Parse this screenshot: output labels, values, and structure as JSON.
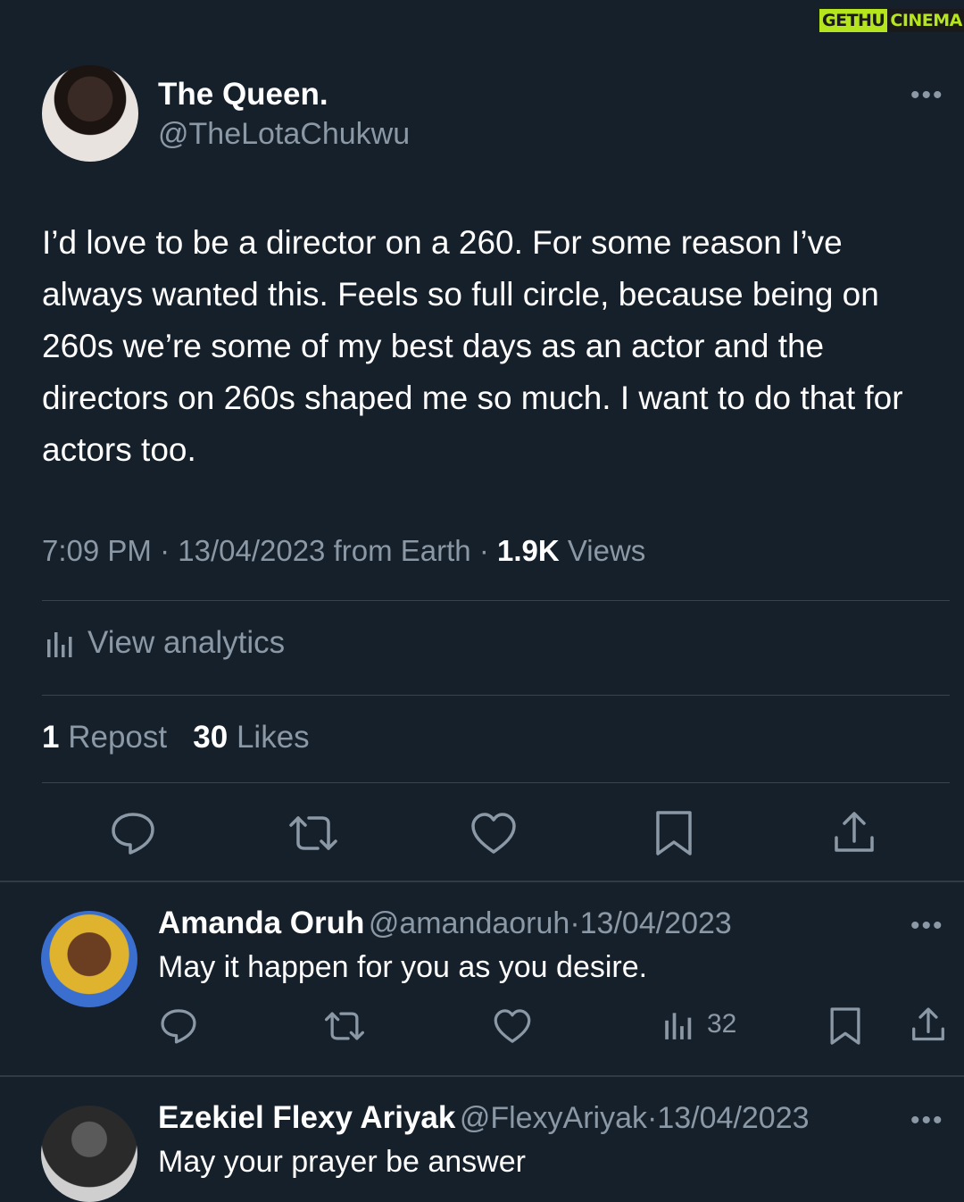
{
  "watermark": {
    "part1": "GETHU",
    "part2": "CINEMA"
  },
  "tweet": {
    "display_name": "The Queen.",
    "handle": "@TheLotaChukwu",
    "more_label": "•••",
    "text": "I’d love to be a director on a 260. For some reason I’ve always wanted this. Feels so full circle, because being on 260s we’re some of my best days as an actor and the directors on 260s shaped me so much. I want to do that for actors too.",
    "time": "7:09 PM",
    "date": "13/04/2023",
    "source": "from Earth",
    "sep": "·",
    "views_count": "1.9K",
    "views_label": "Views",
    "analytics_label": "View analytics",
    "repost_count": "1",
    "repost_label": "Repost",
    "likes_count": "30",
    "likes_label": "Likes",
    "actions": [
      "reply-icon",
      "retweet-icon",
      "heart-icon",
      "bookmark-icon",
      "share-icon"
    ]
  },
  "replies": [
    {
      "display_name": "Amanda Oruh",
      "handle": "@amandaoruh",
      "sep": "·",
      "date": "13/04/2023",
      "text": "May it happen for you as you desire.",
      "views": "32",
      "more_label": "•••"
    },
    {
      "display_name": "Ezekiel Flexy Ariyak",
      "handle": "@FlexyAriyak",
      "sep": "·",
      "date": "13/04/2023",
      "text": "May your prayer be answer",
      "more_label": "•••"
    }
  ],
  "colors": {
    "background": "#15202b",
    "secondary_text": "#8b98a5",
    "divider": "#38444d",
    "watermark_accent": "#b5e61d"
  }
}
